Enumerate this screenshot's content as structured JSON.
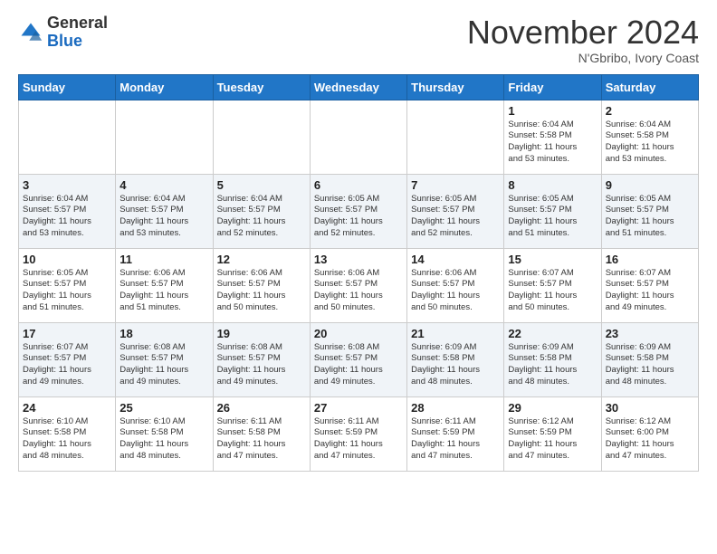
{
  "header": {
    "logo_general": "General",
    "logo_blue": "Blue",
    "month": "November 2024",
    "location": "N'Gbribo, Ivory Coast"
  },
  "weekdays": [
    "Sunday",
    "Monday",
    "Tuesday",
    "Wednesday",
    "Thursday",
    "Friday",
    "Saturday"
  ],
  "weeks": [
    [
      {
        "day": "",
        "info": ""
      },
      {
        "day": "",
        "info": ""
      },
      {
        "day": "",
        "info": ""
      },
      {
        "day": "",
        "info": ""
      },
      {
        "day": "",
        "info": ""
      },
      {
        "day": "1",
        "info": "Sunrise: 6:04 AM\nSunset: 5:58 PM\nDaylight: 11 hours\nand 53 minutes."
      },
      {
        "day": "2",
        "info": "Sunrise: 6:04 AM\nSunset: 5:58 PM\nDaylight: 11 hours\nand 53 minutes."
      }
    ],
    [
      {
        "day": "3",
        "info": "Sunrise: 6:04 AM\nSunset: 5:57 PM\nDaylight: 11 hours\nand 53 minutes."
      },
      {
        "day": "4",
        "info": "Sunrise: 6:04 AM\nSunset: 5:57 PM\nDaylight: 11 hours\nand 53 minutes."
      },
      {
        "day": "5",
        "info": "Sunrise: 6:04 AM\nSunset: 5:57 PM\nDaylight: 11 hours\nand 52 minutes."
      },
      {
        "day": "6",
        "info": "Sunrise: 6:05 AM\nSunset: 5:57 PM\nDaylight: 11 hours\nand 52 minutes."
      },
      {
        "day": "7",
        "info": "Sunrise: 6:05 AM\nSunset: 5:57 PM\nDaylight: 11 hours\nand 52 minutes."
      },
      {
        "day": "8",
        "info": "Sunrise: 6:05 AM\nSunset: 5:57 PM\nDaylight: 11 hours\nand 51 minutes."
      },
      {
        "day": "9",
        "info": "Sunrise: 6:05 AM\nSunset: 5:57 PM\nDaylight: 11 hours\nand 51 minutes."
      }
    ],
    [
      {
        "day": "10",
        "info": "Sunrise: 6:05 AM\nSunset: 5:57 PM\nDaylight: 11 hours\nand 51 minutes."
      },
      {
        "day": "11",
        "info": "Sunrise: 6:06 AM\nSunset: 5:57 PM\nDaylight: 11 hours\nand 51 minutes."
      },
      {
        "day": "12",
        "info": "Sunrise: 6:06 AM\nSunset: 5:57 PM\nDaylight: 11 hours\nand 50 minutes."
      },
      {
        "day": "13",
        "info": "Sunrise: 6:06 AM\nSunset: 5:57 PM\nDaylight: 11 hours\nand 50 minutes."
      },
      {
        "day": "14",
        "info": "Sunrise: 6:06 AM\nSunset: 5:57 PM\nDaylight: 11 hours\nand 50 minutes."
      },
      {
        "day": "15",
        "info": "Sunrise: 6:07 AM\nSunset: 5:57 PM\nDaylight: 11 hours\nand 50 minutes."
      },
      {
        "day": "16",
        "info": "Sunrise: 6:07 AM\nSunset: 5:57 PM\nDaylight: 11 hours\nand 49 minutes."
      }
    ],
    [
      {
        "day": "17",
        "info": "Sunrise: 6:07 AM\nSunset: 5:57 PM\nDaylight: 11 hours\nand 49 minutes."
      },
      {
        "day": "18",
        "info": "Sunrise: 6:08 AM\nSunset: 5:57 PM\nDaylight: 11 hours\nand 49 minutes."
      },
      {
        "day": "19",
        "info": "Sunrise: 6:08 AM\nSunset: 5:57 PM\nDaylight: 11 hours\nand 49 minutes."
      },
      {
        "day": "20",
        "info": "Sunrise: 6:08 AM\nSunset: 5:57 PM\nDaylight: 11 hours\nand 49 minutes."
      },
      {
        "day": "21",
        "info": "Sunrise: 6:09 AM\nSunset: 5:58 PM\nDaylight: 11 hours\nand 48 minutes."
      },
      {
        "day": "22",
        "info": "Sunrise: 6:09 AM\nSunset: 5:58 PM\nDaylight: 11 hours\nand 48 minutes."
      },
      {
        "day": "23",
        "info": "Sunrise: 6:09 AM\nSunset: 5:58 PM\nDaylight: 11 hours\nand 48 minutes."
      }
    ],
    [
      {
        "day": "24",
        "info": "Sunrise: 6:10 AM\nSunset: 5:58 PM\nDaylight: 11 hours\nand 48 minutes."
      },
      {
        "day": "25",
        "info": "Sunrise: 6:10 AM\nSunset: 5:58 PM\nDaylight: 11 hours\nand 48 minutes."
      },
      {
        "day": "26",
        "info": "Sunrise: 6:11 AM\nSunset: 5:58 PM\nDaylight: 11 hours\nand 47 minutes."
      },
      {
        "day": "27",
        "info": "Sunrise: 6:11 AM\nSunset: 5:59 PM\nDaylight: 11 hours\nand 47 minutes."
      },
      {
        "day": "28",
        "info": "Sunrise: 6:11 AM\nSunset: 5:59 PM\nDaylight: 11 hours\nand 47 minutes."
      },
      {
        "day": "29",
        "info": "Sunrise: 6:12 AM\nSunset: 5:59 PM\nDaylight: 11 hours\nand 47 minutes."
      },
      {
        "day": "30",
        "info": "Sunrise: 6:12 AM\nSunset: 6:00 PM\nDaylight: 11 hours\nand 47 minutes."
      }
    ]
  ]
}
